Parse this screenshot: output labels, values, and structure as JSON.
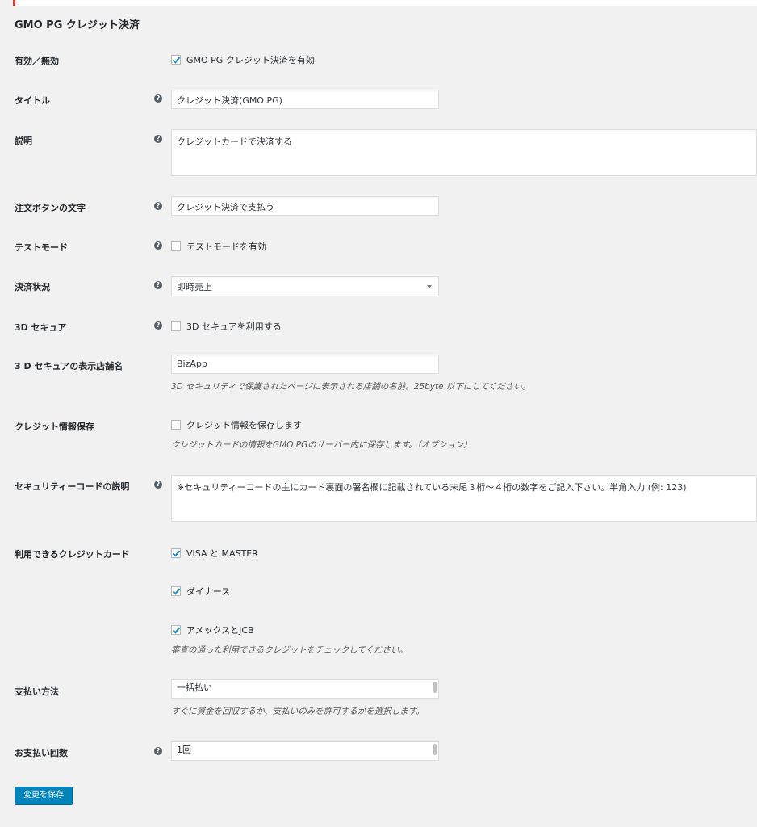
{
  "page": {
    "title": "GMO PG クレジット決済"
  },
  "fields": {
    "enabled": {
      "label": "有効／無効",
      "checkbox_label": "GMO PG クレジット決済を有効"
    },
    "title": {
      "label": "タイトル",
      "value": "クレジット決済(GMO PG)"
    },
    "description": {
      "label": "説明",
      "value": "クレジットカードで決済する"
    },
    "order_button": {
      "label": "注文ボタンの文字",
      "value": "クレジット決済で支払う"
    },
    "test_mode": {
      "label": "テストモード",
      "checkbox_label": "テストモードを有効"
    },
    "payment_status": {
      "label": "決済状況",
      "selected": "即時売上"
    },
    "secure_3d": {
      "label": "3D セキュア",
      "checkbox_label": "3D セキュアを利用する"
    },
    "shop_name_3d": {
      "label": "3 D セキュアの表示店舗名",
      "value": "BizApp",
      "description": "3D セキュリティで保護されたページに表示される店舗の名前。25byte 以下にしてください。"
    },
    "save_credit": {
      "label": "クレジット情報保存",
      "checkbox_label": "クレジット情報を保存します",
      "description": "クレジットカードの情報をGMO PGのサーバー内に保存します。（オプション）"
    },
    "security_code": {
      "label": "セキュリティーコードの説明",
      "value": "※セキュリティーコードの主にカード裏面の署名欄に記載されている末尾３桁～４桁の数字をご記入下さい。半角入力 (例: 123)"
    },
    "cards": {
      "label": "利用できるクレジットカード",
      "options": [
        "VISA と MASTER",
        "ダイナース",
        "アメックスとJCB"
      ],
      "description": "審査の通った利用できるクレジットをチェックしてください。"
    },
    "payment_method": {
      "label": "支払い方法",
      "visible_option": "一括払い",
      "description": "すぐに資金を回収するか、支払いのみを許可するかを選択します。"
    },
    "installments": {
      "label": "お支払い回数",
      "visible_option": "1回"
    }
  },
  "actions": {
    "save_label": "変更を保存"
  },
  "colors": {
    "primary": "#0085ba",
    "background": "#f1f1f1",
    "accent_red": "#dc3232",
    "check": "#1e8cbe"
  }
}
